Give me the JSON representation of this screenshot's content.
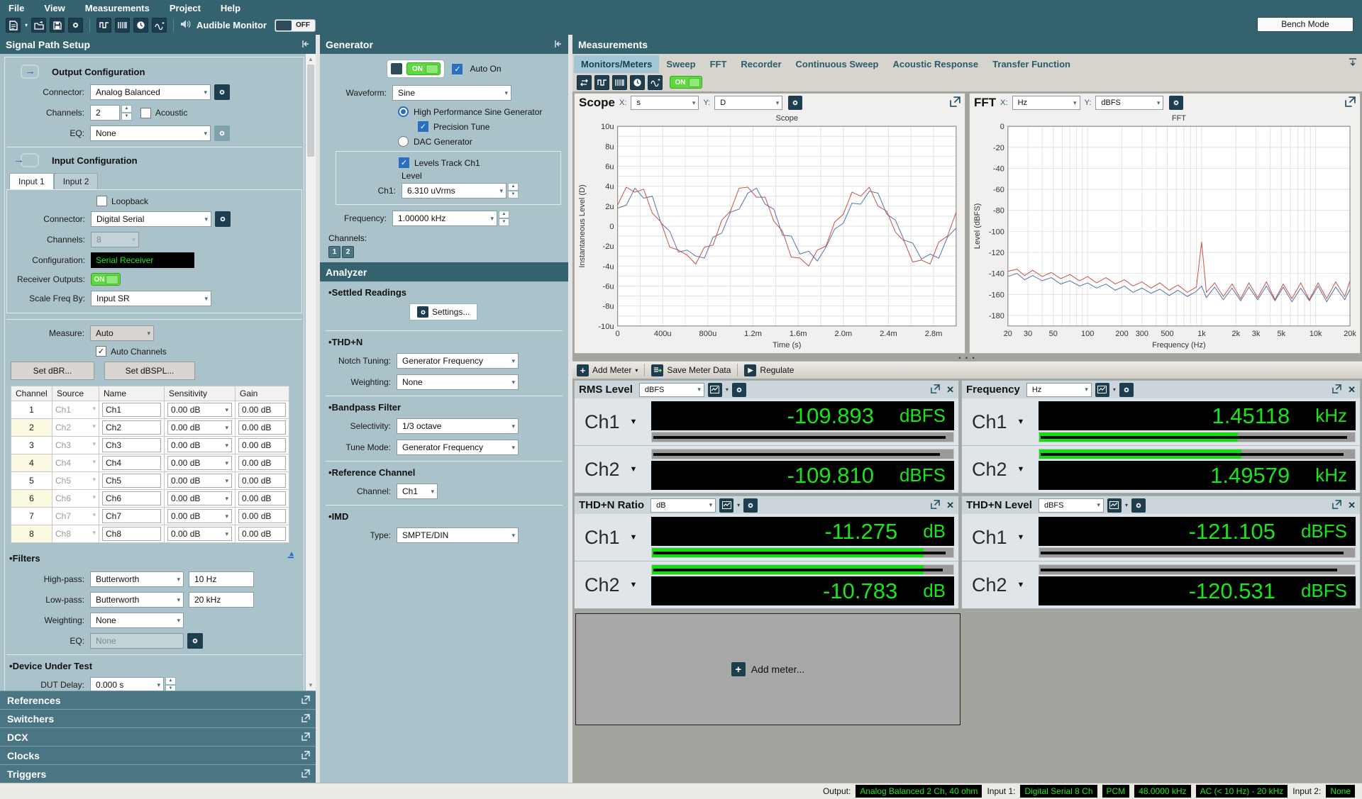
{
  "icons": {
    "dropdown": "▾",
    "spin_up": "▲",
    "spin_down": "▼",
    "check": "✓",
    "close": "✕",
    "tri_down": "▼",
    "play": "▶",
    "plus": "+",
    "splitter_dots": "• • •",
    "scroll_up": "▲",
    "scroll_down": "▼"
  },
  "menu": {
    "items": [
      "File",
      "View",
      "Measurements",
      "Project",
      "Help"
    ]
  },
  "toolbar": {
    "audible_monitor_label": "Audible Monitor",
    "audible_monitor_state": "OFF",
    "bench_mode_label": "Bench Mode"
  },
  "signal_path": {
    "title": "Signal Path Setup",
    "output": {
      "heading": "Output Configuration",
      "connector_label": "Connector:",
      "connector_value": "Analog Balanced",
      "channels_label": "Channels:",
      "channels_value": "2",
      "acoustic_label": "Acoustic",
      "eq_label": "EQ:",
      "eq_value": "None"
    },
    "input": {
      "heading": "Input Configuration",
      "tab1": "Input 1",
      "tab2": "Input 2",
      "loopback_label": "Loopback",
      "connector_label": "Connector:",
      "connector_value": "Digital Serial",
      "channels_label": "Channels:",
      "channels_value": "8",
      "configuration_label": "Configuration:",
      "configuration_value": "Serial Receiver",
      "receiver_label": "Receiver Outputs:",
      "receiver_state": "ON",
      "scale_label": "Scale Freq By:",
      "scale_value": "Input SR"
    },
    "measure_label": "Measure:",
    "measure_value": "Auto",
    "auto_channels_label": "Auto Channels",
    "set_dbr": "Set dBR...",
    "set_dbspl": "Set dBSPL...",
    "table": {
      "h": [
        "Channel",
        "Source",
        "Name",
        "Sensitivity",
        "Gain"
      ],
      "rows": [
        [
          "1",
          "Ch1",
          "Ch1",
          "0.00 dB",
          "0.00 dB"
        ],
        [
          "2",
          "Ch2",
          "Ch2",
          "0.00 dB",
          "0.00 dB"
        ],
        [
          "3",
          "Ch3",
          "Ch3",
          "0.00 dB",
          "0.00 dB"
        ],
        [
          "4",
          "Ch4",
          "Ch4",
          "0.00 dB",
          "0.00 dB"
        ],
        [
          "5",
          "Ch5",
          "Ch5",
          "0.00 dB",
          "0.00 dB"
        ],
        [
          "6",
          "Ch6",
          "Ch6",
          "0.00 dB",
          "0.00 dB"
        ],
        [
          "7",
          "Ch7",
          "Ch7",
          "0.00 dB",
          "0.00 dB"
        ],
        [
          "8",
          "Ch8",
          "Ch8",
          "0.00 dB",
          "0.00 dB"
        ]
      ]
    },
    "filters": {
      "heading": "Filters",
      "hp_label": "High-pass:",
      "hp_type": "Butterworth",
      "hp_value": "10 Hz",
      "lp_label": "Low-pass:",
      "lp_type": "Butterworth",
      "lp_value": "20 kHz",
      "w_label": "Weighting:",
      "w_value": "None",
      "eq_label": "EQ:",
      "eq_value": "None"
    },
    "dut": {
      "heading": "Device Under Test",
      "delay_label": "DUT Delay:",
      "delay_value": "0.000 s"
    },
    "sections": [
      "References",
      "Switchers",
      "DCX",
      "Clocks",
      "Triggers"
    ]
  },
  "generator": {
    "title": "Generator",
    "on_state": "ON",
    "auto_on_label": "Auto On",
    "waveform_label": "Waveform:",
    "waveform_value": "Sine",
    "hp_sine_label": "High Performance Sine Generator",
    "precision_label": "Precision Tune",
    "dac_label": "DAC Generator",
    "levels_track_label": "Levels Track Ch1",
    "level_label": "Level",
    "ch1_label": "Ch1:",
    "ch1_value": "6.310 uVrms",
    "frequency_label": "Frequency:",
    "frequency_value": "1.00000 kHz",
    "channels_label": "Channels:",
    "ch_btn_1": "1",
    "ch_btn_2": "2"
  },
  "analyzer": {
    "title": "Analyzer",
    "settled_heading": "Settled Readings",
    "settings_btn": "Settings...",
    "thdn_heading": "THD+N",
    "notch_label": "Notch Tuning:",
    "notch_value": "Generator Frequency",
    "weighting_label": "Weighting:",
    "weighting_value": "None",
    "bandpass_heading": "Bandpass Filter",
    "selectivity_label": "Selectivity:",
    "selectivity_value": "1/3 octave",
    "tune_label": "Tune Mode:",
    "tune_value": "Generator Frequency",
    "ref_heading": "Reference Channel",
    "ref_channel_label": "Channel:",
    "ref_channel_value": "Ch1",
    "imd_heading": "IMD",
    "imd_type_label": "Type:",
    "imd_type_value": "SMPTE/DIN"
  },
  "measurements": {
    "title": "Measurements",
    "tabs": [
      "Monitors/Meters",
      "Sweep",
      "FFT",
      "Recorder",
      "Continuous Sweep",
      "Acoustic Response",
      "Transfer Function"
    ],
    "active_tab": "Monitors/Meters",
    "monitor_on_state": "ON",
    "add_meter_btn": "Add Meter",
    "save_meter_btn": "Save Meter Data",
    "regulate_btn": "Regulate",
    "add_meter_placeholder": "Add meter..."
  },
  "scope_panel": {
    "title": "Scope",
    "x_label": "X:",
    "x_value": "s",
    "y_label": "Y:",
    "y_value": "D"
  },
  "fft_panel": {
    "title": "FFT",
    "x_label": "X:",
    "x_value": "Hz",
    "y_label": "Y:",
    "y_value": "dBFS"
  },
  "meters": [
    {
      "title": "RMS Level",
      "unit": "dBFS",
      "channels": [
        {
          "name": "Ch1",
          "value": "-109.893",
          "unit": "dBFS",
          "fill_pct": 0,
          "stripe_pct": 97
        },
        {
          "name": "Ch2",
          "value": "-109.810",
          "unit": "dBFS",
          "fill_pct": 0,
          "stripe_pct": 95
        }
      ]
    },
    {
      "title": "Frequency",
      "unit": "Hz",
      "channels": [
        {
          "name": "Ch1",
          "value": "1.45118",
          "unit": "kHz",
          "fill_pct": 63,
          "stripe_pct": 97
        },
        {
          "name": "Ch2",
          "value": "1.49579",
          "unit": "kHz",
          "fill_pct": 64,
          "stripe_pct": 96
        }
      ]
    },
    {
      "title": "THD+N Ratio",
      "unit": "dB",
      "channels": [
        {
          "name": "Ch1",
          "value": "-11.275",
          "unit": "dB",
          "fill_pct": 90,
          "stripe_pct": 97
        },
        {
          "name": "Ch2",
          "value": "-10.783",
          "unit": "dB",
          "fill_pct": 90,
          "stripe_pct": 96
        }
      ]
    },
    {
      "title": "THD+N Level",
      "unit": "dBFS",
      "channels": [
        {
          "name": "Ch1",
          "value": "-121.105",
          "unit": "dBFS",
          "fill_pct": 0,
          "stripe_pct": 96
        },
        {
          "name": "Ch2",
          "value": "-120.531",
          "unit": "dBFS",
          "fill_pct": 0,
          "stripe_pct": 94
        }
      ]
    }
  ],
  "status_bar": {
    "output_label": "Output:",
    "output_value": "Analog Balanced 2 Ch, 40 ohm",
    "input1_label": "Input 1:",
    "badge1": "Digital Serial 8 Ch",
    "badge2": "PCM",
    "badge3": "48.0000 kHz",
    "badge4": "AC (< 10 Hz) - 20 kHz",
    "input2_label": "Input 2:",
    "input2_value": "None"
  },
  "chart_data": [
    {
      "type": "line",
      "title": "Scope",
      "xlabel": "Time (s)",
      "ylabel": "Instantaneous Level (D)",
      "x_tick_values_ms": [
        0,
        0.4,
        0.8,
        1.2,
        1.6,
        2.0,
        2.4,
        2.8
      ],
      "x_ticks": [
        "0",
        "400u",
        "800u",
        "1.2m",
        "1.6m",
        "2.0m",
        "2.4m",
        "2.8m"
      ],
      "xlim_ms": [
        0,
        3.0
      ],
      "y_tick_values_u": [
        10,
        8,
        6,
        4,
        2,
        0,
        -2,
        -4,
        -6,
        -8,
        -10
      ],
      "y_ticks": [
        "10u",
        "8u",
        "6u",
        "4u",
        "2u",
        "0",
        "-2u",
        "-4u",
        "-6u",
        "-8u",
        "-10u"
      ],
      "ylim_u": [
        -10,
        10
      ],
      "grid": true,
      "legend": "none",
      "series": [
        {
          "name": "Ch1",
          "color": "#5571a8",
          "values_u": [
            1.8,
            2.1,
            3.8,
            2.8,
            3.0,
            0.3,
            -0.5,
            -2.6,
            -2.4,
            -3.0,
            -3.2,
            -1.1,
            -0.7,
            1.4,
            1.7,
            3.3,
            3.8,
            2.2,
            1.7,
            -0.9,
            -1.0,
            -2.8,
            -2.5,
            -3.5,
            -2.1,
            -0.3,
            0.3,
            2.3,
            2.2,
            3.5,
            3.3,
            1.2,
            0.6,
            -1.4,
            -1.7,
            -3.3,
            -2.8,
            -3.2,
            -1.1,
            -0.2
          ]
        },
        {
          "name": "Ch2",
          "color": "#c4524c",
          "values_u": [
            2.1,
            3.9,
            3.4,
            3.7,
            1.3,
            0.4,
            -2.1,
            -2.4,
            -2.9,
            -3.8,
            -2.1,
            -1.9,
            0.6,
            1.5,
            3.8,
            3.9,
            2.9,
            2.9,
            0.5,
            -0.5,
            -3.1,
            -3.2,
            -4.0,
            -2.4,
            -2.0,
            0.4,
            1.2,
            3.4,
            3.0,
            3.9,
            2.0,
            1.5,
            -0.6,
            -1.5,
            -3.6,
            -3.4,
            -3.8,
            -1.6,
            -1.0,
            1.4
          ]
        }
      ]
    },
    {
      "type": "line",
      "title": "FFT",
      "xlabel": "Frequency (Hz)",
      "ylabel": "Level (dBFS)",
      "xscale": "log",
      "xlim": [
        20,
        20000
      ],
      "x_tick_values": [
        20,
        30,
        50,
        100,
        200,
        300,
        500,
        1000,
        2000,
        3000,
        5000,
        10000,
        20000
      ],
      "x_tick_labels": [
        "20",
        "30",
        "50",
        "100",
        "200",
        "300",
        "500",
        "1k",
        "2k",
        "3k",
        "5k",
        "10k",
        "20k"
      ],
      "ylim": [
        -190,
        0
      ],
      "y_tick_values": [
        0,
        -20,
        -40,
        -60,
        -80,
        -100,
        -120,
        -140,
        -160,
        -180
      ],
      "grid": true,
      "legend": "none",
      "series": [
        {
          "name": "Ch1",
          "color": "#5571a8",
          "points": [
            [
              20,
              -143
            ],
            [
              24,
              -140
            ],
            [
              28,
              -146
            ],
            [
              33,
              -142
            ],
            [
              40,
              -147
            ],
            [
              48,
              -144
            ],
            [
              58,
              -150
            ],
            [
              70,
              -147
            ],
            [
              85,
              -152
            ],
            [
              100,
              -149
            ],
            [
              120,
              -154
            ],
            [
              145,
              -150
            ],
            [
              175,
              -156
            ],
            [
              210,
              -152
            ],
            [
              250,
              -158
            ],
            [
              300,
              -154
            ],
            [
              360,
              -159
            ],
            [
              430,
              -155
            ],
            [
              520,
              -161
            ],
            [
              620,
              -156
            ],
            [
              750,
              -162
            ],
            [
              900,
              -157
            ],
            [
              1000,
              -152
            ],
            [
              1100,
              -163
            ],
            [
              1300,
              -153
            ],
            [
              1550,
              -165
            ],
            [
              1850,
              -154
            ],
            [
              2200,
              -166
            ],
            [
              2600,
              -153
            ],
            [
              3100,
              -165
            ],
            [
              3700,
              -152
            ],
            [
              4400,
              -166
            ],
            [
              5200,
              -153
            ],
            [
              6200,
              -167
            ],
            [
              7400,
              -154
            ],
            [
              8800,
              -166
            ],
            [
              10500,
              -152
            ],
            [
              12500,
              -167
            ],
            [
              15000,
              -153
            ],
            [
              18000,
              -165
            ],
            [
              20000,
              -155
            ]
          ]
        },
        {
          "name": "Ch2",
          "color": "#c4524c",
          "points": [
            [
              20,
              -138
            ],
            [
              24,
              -136
            ],
            [
              28,
              -142
            ],
            [
              33,
              -137
            ],
            [
              40,
              -143
            ],
            [
              48,
              -139
            ],
            [
              58,
              -145
            ],
            [
              70,
              -141
            ],
            [
              85,
              -147
            ],
            [
              100,
              -143
            ],
            [
              120,
              -149
            ],
            [
              145,
              -144
            ],
            [
              175,
              -150
            ],
            [
              210,
              -146
            ],
            [
              250,
              -152
            ],
            [
              300,
              -148
            ],
            [
              360,
              -154
            ],
            [
              430,
              -149
            ],
            [
              520,
              -156
            ],
            [
              620,
              -151
            ],
            [
              750,
              -158
            ],
            [
              900,
              -153
            ],
            [
              1000,
              -110
            ],
            [
              1100,
              -158
            ],
            [
              1300,
              -149
            ],
            [
              1550,
              -162
            ],
            [
              1850,
              -150
            ],
            [
              2200,
              -164
            ],
            [
              2600,
              -149
            ],
            [
              3100,
              -163
            ],
            [
              3700,
              -148
            ],
            [
              4400,
              -165
            ],
            [
              5200,
              -150
            ],
            [
              6200,
              -164
            ],
            [
              7400,
              -149
            ],
            [
              8800,
              -165
            ],
            [
              10500,
              -149
            ],
            [
              12500,
              -164
            ],
            [
              15000,
              -148
            ],
            [
              18000,
              -162
            ],
            [
              20000,
              -147
            ]
          ]
        }
      ]
    }
  ]
}
